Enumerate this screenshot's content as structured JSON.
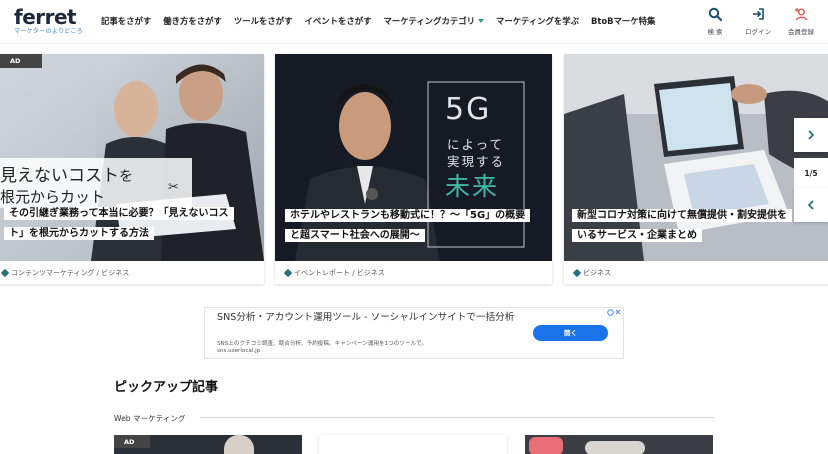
{
  "logo": {
    "word": "ferret",
    "tagline": "マーケターのよりどころ"
  },
  "nav": [
    {
      "label": "記事をさがす"
    },
    {
      "label": "働き方をさがす"
    },
    {
      "label": "ツールをさがす"
    },
    {
      "label": "イベントをさがす"
    },
    {
      "label": "マーケティングカテゴリ"
    },
    {
      "label": "マーケティングを学ぶ"
    },
    {
      "label": "BtoBマーケ特集"
    }
  ],
  "header_actions": {
    "search": "検 索",
    "login": "ログイン",
    "signup": "会員登録"
  },
  "carousel": {
    "pager": "1/5",
    "cards": [
      {
        "badge": "AD",
        "image_text_1": "見えないコスト",
        "image_text_1b": "を",
        "image_text_2": "根元からカット",
        "headline_1": "その引継ぎ業務って本当に必要？「見えないコス",
        "headline_2": "ト」を根元からカットする方法",
        "tag": "コンテンツマーケティング / ビジネス"
      },
      {
        "image_text_big": "5G",
        "image_text_1": "によって",
        "image_text_2": "実現する",
        "image_text_3": "未来",
        "headline_1": "ホテルやレストランも移動式に！？〜「5G」の概要",
        "headline_2": "と超スマート社会への展開〜",
        "tag": "イベントレポート / ビジネス"
      },
      {
        "headline_1": "新型コロナ対策に向けて無償提供・割安提供を",
        "headline_2": "いるサービス・企業まとめ",
        "tag": "ビジネス"
      }
    ]
  },
  "ad_banner": {
    "title": "SNS分析・アカウント運用ツール - ソーシャルインサイトで一括分析",
    "desc": "SNS上のクチコミ調査、競合分析、予約投稿、キャンペーン運用を1つのツールで。",
    "url": "sns.userlocal.jp",
    "button": "開く"
  },
  "pickup": {
    "title": "ピックアップ記事",
    "category": "Web マーケティング",
    "ad_badge": "AD"
  },
  "colors": {
    "accent": "#1c6b7c",
    "brand_blue": "#3a89c9",
    "ad_button": "#1a73e8",
    "teal_text": "#3fb7a6"
  }
}
